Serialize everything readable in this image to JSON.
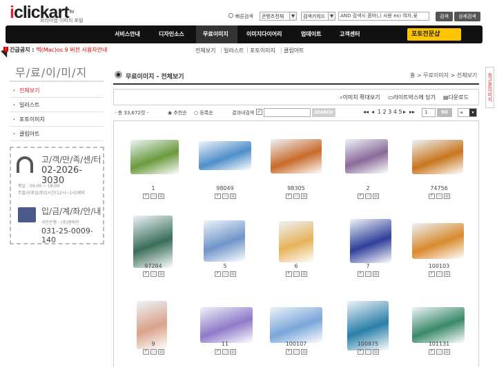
{
  "header": {
    "logo_prefix": "i",
    "logo_rest": "clickart",
    "logo_tm": "TM",
    "tagline": "프리미엄 이미지 포털",
    "quick_search_label": "빠른검색",
    "content_select": "콘텐츠전체",
    "keyword_select": "검색키워드",
    "search_placeholder": "AND 검색시 콤마(,) 사용 ex) 여자,꽃",
    "search_button": "검색",
    "detail_search_button": "상세검색"
  },
  "nav": {
    "items": [
      "서비스안내",
      "디자인소스",
      "무료이미지",
      "이미지다이어리",
      "업데이트",
      "고객센터"
    ],
    "active_index": 2,
    "photo_banner": "포토전문샵"
  },
  "notice": {
    "label": "긴급공지 :",
    "text": "맥(Mac)os 9 버전 사용자안내"
  },
  "subnav": {
    "items": [
      "전체보기",
      "일러스트",
      "포토이미지",
      "클립아트"
    ]
  },
  "sidebar": {
    "title": "무/료/이/미/지",
    "items": [
      {
        "label": "전체보기",
        "active": true
      },
      {
        "label": "일러스트",
        "active": false
      },
      {
        "label": "포토이미지",
        "active": false
      },
      {
        "label": "클립아트",
        "active": false
      }
    ],
    "cs_title": "고/객/만/족/센/터",
    "cs_phone": "02-2026-3030",
    "cs_hours1": "평일 : 09:00 ~ 18:00",
    "cs_hours2": "주말/공휴일/점심시간(12시~1시)제외",
    "deposit_title": "입/금/계/좌/안/내",
    "deposit_bank": "국민은행 - (주)엔파인",
    "deposit_account": "031-25-0009-140"
  },
  "main": {
    "title": "무료이미지 - 전체보기",
    "breadcrumb": "홈 > 무료이미지 > 전체보기",
    "tools": [
      "이미지 확대보기",
      "라이트박스에 담기",
      "다운로드"
    ],
    "total": "- 총 33,672컷 -",
    "sort_recommend": "추천순",
    "sort_date": "등록순",
    "search_in_results": "결과내검색",
    "search_btn": "SEARCH",
    "pages": "1 2 3 4 5",
    "page_input": "1",
    "go_label": "60",
    "items": [
      {
        "id": "1",
        "color": "#6a9a3c"
      },
      {
        "id": "98049",
        "color": "#4e8fc9"
      },
      {
        "id": "98305",
        "color": "#c96a2a"
      },
      {
        "id": "2",
        "color": "#8a6a9a"
      },
      {
        "id": "74756",
        "color": "#c8761e"
      },
      {
        "id": "97284",
        "color": "#3a6e5a"
      },
      {
        "id": "5",
        "color": "#6f95c9"
      },
      {
        "id": "6",
        "color": "#e6b35a"
      },
      {
        "id": "7",
        "color": "#2f3f9a"
      },
      {
        "id": "100103",
        "color": "#d98a2e"
      },
      {
        "id": "9",
        "color": "#d9a28a"
      },
      {
        "id": "11",
        "color": "#8f7ac9"
      },
      {
        "id": "100107",
        "color": "#7aa6d9"
      },
      {
        "id": "100875",
        "color": "#2a7fa8"
      },
      {
        "id": "101131",
        "color": "#3a8a6a"
      }
    ]
  },
  "right_tab": "최근본이미지"
}
